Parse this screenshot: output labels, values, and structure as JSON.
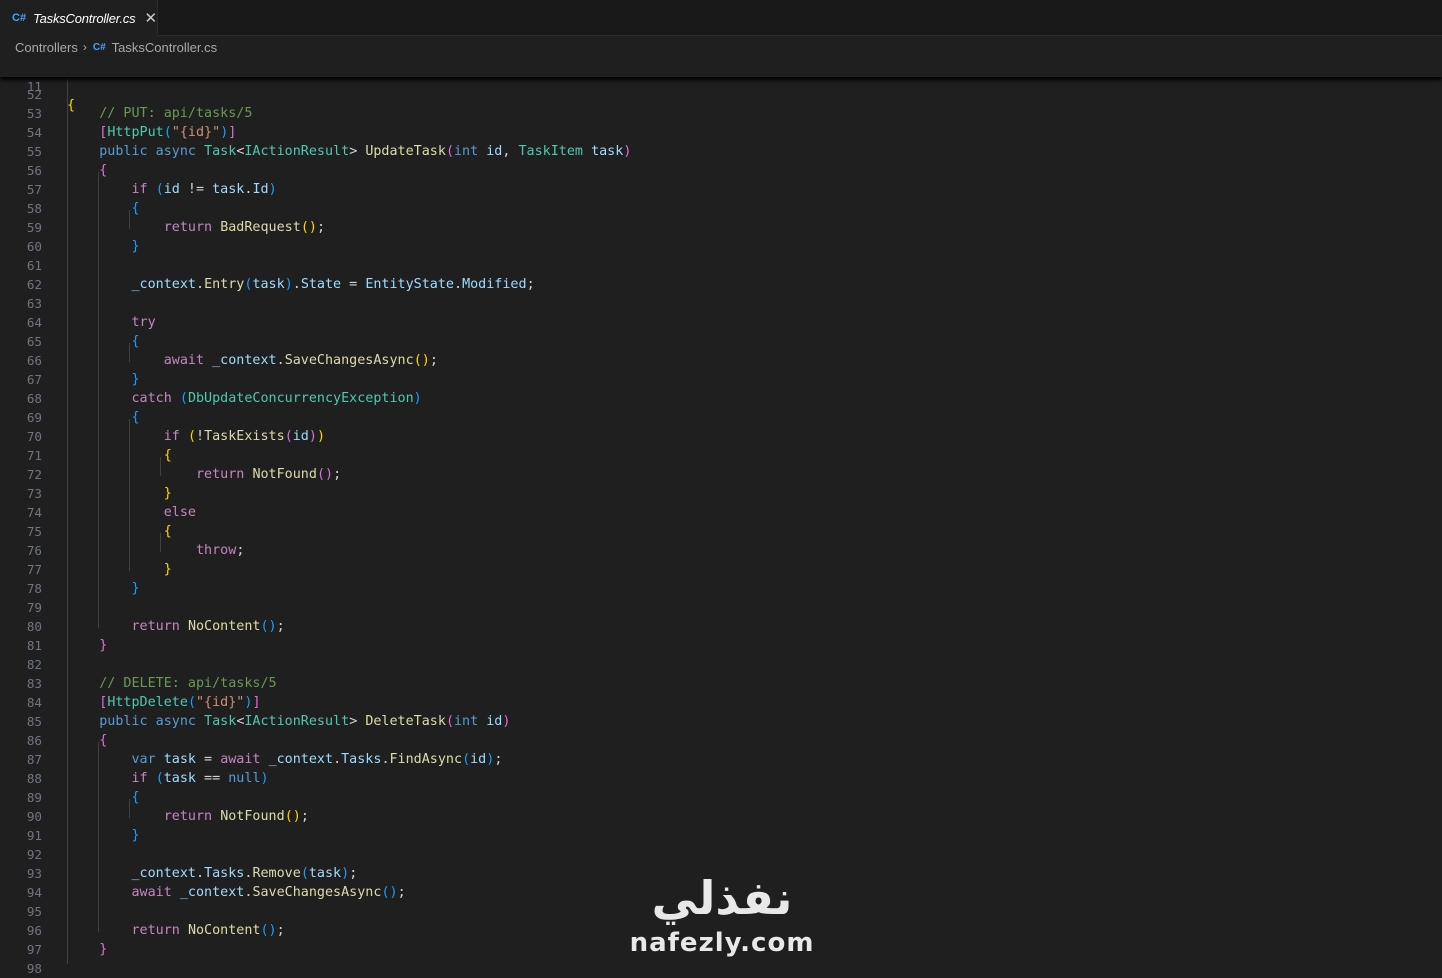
{
  "tab": {
    "icon": "csharp-file-icon",
    "label": "TasksController.cs",
    "close_glyph": "✕"
  },
  "breadcrumb": {
    "folder": "Controllers",
    "separator": "›",
    "file": "TasksController.cs",
    "file_icon": "csharp-file-icon"
  },
  "sticky": {
    "line_number": "11",
    "text": "{"
  },
  "lines": [
    {
      "n": "52",
      "tokens": []
    },
    {
      "n": "53",
      "tokens": [
        [
          "cm",
          "    // PUT: api/tasks/5"
        ]
      ]
    },
    {
      "n": "54",
      "tokens": [
        [
          "b2",
          "    ["
        ],
        [
          "ty",
          "HttpPut"
        ],
        [
          "b3",
          "("
        ],
        [
          "st",
          "\"{id}\""
        ],
        [
          "b3",
          ")"
        ],
        [
          "b2",
          "]"
        ]
      ]
    },
    {
      "n": "55",
      "tokens": [
        [
          "kw",
          "    public async "
        ],
        [
          "ty",
          "Task"
        ],
        [
          "p",
          "<"
        ],
        [
          "ty",
          "IActionResult"
        ],
        [
          "p",
          "> "
        ],
        [
          "fn",
          "UpdateTask"
        ],
        [
          "b2",
          "("
        ],
        [
          "kw",
          "int "
        ],
        [
          "va",
          "id"
        ],
        [
          "p",
          ", "
        ],
        [
          "ty",
          "TaskItem "
        ],
        [
          "va",
          "task"
        ],
        [
          "b2",
          ")"
        ]
      ]
    },
    {
      "n": "56",
      "tokens": [
        [
          "b2",
          "    {"
        ]
      ]
    },
    {
      "n": "57",
      "tokens": [
        [
          "ctl",
          "        if "
        ],
        [
          "b3",
          "("
        ],
        [
          "va",
          "id"
        ],
        [
          "p",
          " != "
        ],
        [
          "va",
          "task"
        ],
        [
          "p",
          "."
        ],
        [
          "va",
          "Id"
        ],
        [
          "b3",
          ")"
        ]
      ]
    },
    {
      "n": "58",
      "tokens": [
        [
          "b3",
          "        {"
        ]
      ]
    },
    {
      "n": "59",
      "tokens": [
        [
          "ctl",
          "            return "
        ],
        [
          "fn",
          "BadRequest"
        ],
        [
          "b1",
          "()"
        ],
        [
          "p",
          ";"
        ]
      ]
    },
    {
      "n": "60",
      "tokens": [
        [
          "b3",
          "        }"
        ]
      ]
    },
    {
      "n": "61",
      "tokens": []
    },
    {
      "n": "62",
      "tokens": [
        [
          "va",
          "        _context"
        ],
        [
          "p",
          "."
        ],
        [
          "fn",
          "Entry"
        ],
        [
          "b3",
          "("
        ],
        [
          "va",
          "task"
        ],
        [
          "b3",
          ")"
        ],
        [
          "p",
          "."
        ],
        [
          "va",
          "State"
        ],
        [
          "p",
          " = "
        ],
        [
          "va",
          "EntityState"
        ],
        [
          "p",
          "."
        ],
        [
          "va",
          "Modified"
        ],
        [
          "p",
          ";"
        ]
      ]
    },
    {
      "n": "63",
      "tokens": []
    },
    {
      "n": "64",
      "tokens": [
        [
          "ctl",
          "        try"
        ]
      ]
    },
    {
      "n": "65",
      "tokens": [
        [
          "b3",
          "        {"
        ]
      ]
    },
    {
      "n": "66",
      "tokens": [
        [
          "ctl",
          "            await "
        ],
        [
          "va",
          "_context"
        ],
        [
          "p",
          "."
        ],
        [
          "fn",
          "SaveChangesAsync"
        ],
        [
          "b1",
          "()"
        ],
        [
          "p",
          ";"
        ]
      ]
    },
    {
      "n": "67",
      "tokens": [
        [
          "b3",
          "        }"
        ]
      ]
    },
    {
      "n": "68",
      "tokens": [
        [
          "ctl",
          "        catch "
        ],
        [
          "b3",
          "("
        ],
        [
          "ty",
          "DbUpdateConcurrencyException"
        ],
        [
          "b3",
          ")"
        ]
      ]
    },
    {
      "n": "69",
      "tokens": [
        [
          "b3",
          "        {"
        ]
      ]
    },
    {
      "n": "70",
      "tokens": [
        [
          "ctl",
          "            if "
        ],
        [
          "b1",
          "("
        ],
        [
          "p",
          "!"
        ],
        [
          "fn",
          "TaskExists"
        ],
        [
          "b2",
          "("
        ],
        [
          "va",
          "id"
        ],
        [
          "b2",
          ")"
        ],
        [
          "b1",
          ")"
        ]
      ]
    },
    {
      "n": "71",
      "tokens": [
        [
          "b1",
          "            {"
        ]
      ]
    },
    {
      "n": "72",
      "tokens": [
        [
          "ctl",
          "                return "
        ],
        [
          "fn",
          "NotFound"
        ],
        [
          "b2",
          "()"
        ],
        [
          "p",
          ";"
        ]
      ]
    },
    {
      "n": "73",
      "tokens": [
        [
          "b1",
          "            }"
        ]
      ]
    },
    {
      "n": "74",
      "tokens": [
        [
          "ctl",
          "            else"
        ]
      ]
    },
    {
      "n": "75",
      "tokens": [
        [
          "b1",
          "            {"
        ]
      ]
    },
    {
      "n": "76",
      "tokens": [
        [
          "ctl",
          "                throw"
        ],
        [
          "p",
          ";"
        ]
      ]
    },
    {
      "n": "77",
      "tokens": [
        [
          "b1",
          "            }"
        ]
      ]
    },
    {
      "n": "78",
      "tokens": [
        [
          "b3",
          "        }"
        ]
      ]
    },
    {
      "n": "79",
      "tokens": []
    },
    {
      "n": "80",
      "tokens": [
        [
          "ctl",
          "        return "
        ],
        [
          "fn",
          "NoContent"
        ],
        [
          "b3",
          "()"
        ],
        [
          "p",
          ";"
        ]
      ]
    },
    {
      "n": "81",
      "tokens": [
        [
          "b2",
          "    }"
        ]
      ]
    },
    {
      "n": "82",
      "tokens": []
    },
    {
      "n": "83",
      "tokens": [
        [
          "cm",
          "    // DELETE: api/tasks/5"
        ]
      ]
    },
    {
      "n": "84",
      "tokens": [
        [
          "b2",
          "    ["
        ],
        [
          "ty",
          "HttpDelete"
        ],
        [
          "b3",
          "("
        ],
        [
          "st",
          "\"{id}\""
        ],
        [
          "b3",
          ")"
        ],
        [
          "b2",
          "]"
        ]
      ]
    },
    {
      "n": "85",
      "tokens": [
        [
          "kw",
          "    public async "
        ],
        [
          "ty",
          "Task"
        ],
        [
          "p",
          "<"
        ],
        [
          "ty",
          "IActionResult"
        ],
        [
          "p",
          "> "
        ],
        [
          "fn",
          "DeleteTask"
        ],
        [
          "b2",
          "("
        ],
        [
          "kw",
          "int "
        ],
        [
          "va",
          "id"
        ],
        [
          "b2",
          ")"
        ]
      ]
    },
    {
      "n": "86",
      "tokens": [
        [
          "b2",
          "    {"
        ]
      ]
    },
    {
      "n": "87",
      "tokens": [
        [
          "kw",
          "        var "
        ],
        [
          "va",
          "task"
        ],
        [
          "p",
          " = "
        ],
        [
          "ctl",
          "await "
        ],
        [
          "va",
          "_context"
        ],
        [
          "p",
          "."
        ],
        [
          "va",
          "Tasks"
        ],
        [
          "p",
          "."
        ],
        [
          "fn",
          "FindAsync"
        ],
        [
          "b3",
          "("
        ],
        [
          "va",
          "id"
        ],
        [
          "b3",
          ")"
        ],
        [
          "p",
          ";"
        ]
      ]
    },
    {
      "n": "88",
      "tokens": [
        [
          "ctl",
          "        if "
        ],
        [
          "b3",
          "("
        ],
        [
          "va",
          "task"
        ],
        [
          "p",
          " == "
        ],
        [
          "kw",
          "null"
        ],
        [
          "b3",
          ")"
        ]
      ]
    },
    {
      "n": "89",
      "tokens": [
        [
          "b3",
          "        {"
        ]
      ]
    },
    {
      "n": "90",
      "tokens": [
        [
          "ctl",
          "            return "
        ],
        [
          "fn",
          "NotFound"
        ],
        [
          "b1",
          "()"
        ],
        [
          "p",
          ";"
        ]
      ]
    },
    {
      "n": "91",
      "tokens": [
        [
          "b3",
          "        }"
        ]
      ]
    },
    {
      "n": "92",
      "tokens": []
    },
    {
      "n": "93",
      "tokens": [
        [
          "va",
          "        _context"
        ],
        [
          "p",
          "."
        ],
        [
          "va",
          "Tasks"
        ],
        [
          "p",
          "."
        ],
        [
          "fn",
          "Remove"
        ],
        [
          "b3",
          "("
        ],
        [
          "va",
          "task"
        ],
        [
          "b3",
          ")"
        ],
        [
          "p",
          ";"
        ]
      ]
    },
    {
      "n": "94",
      "tokens": [
        [
          "ctl",
          "        await "
        ],
        [
          "va",
          "_context"
        ],
        [
          "p",
          "."
        ],
        [
          "fn",
          "SaveChangesAsync"
        ],
        [
          "b3",
          "()"
        ],
        [
          "p",
          ";"
        ]
      ]
    },
    {
      "n": "95",
      "tokens": []
    },
    {
      "n": "96",
      "tokens": [
        [
          "ctl",
          "        return "
        ],
        [
          "fn",
          "NoContent"
        ],
        [
          "b3",
          "()"
        ],
        [
          "p",
          ";"
        ]
      ]
    },
    {
      "n": "97",
      "tokens": [
        [
          "b2",
          "    }"
        ]
      ]
    },
    {
      "n": "98",
      "tokens": []
    }
  ],
  "watermark": {
    "arabic": "نفذلي",
    "latin": "nafezly.com"
  }
}
